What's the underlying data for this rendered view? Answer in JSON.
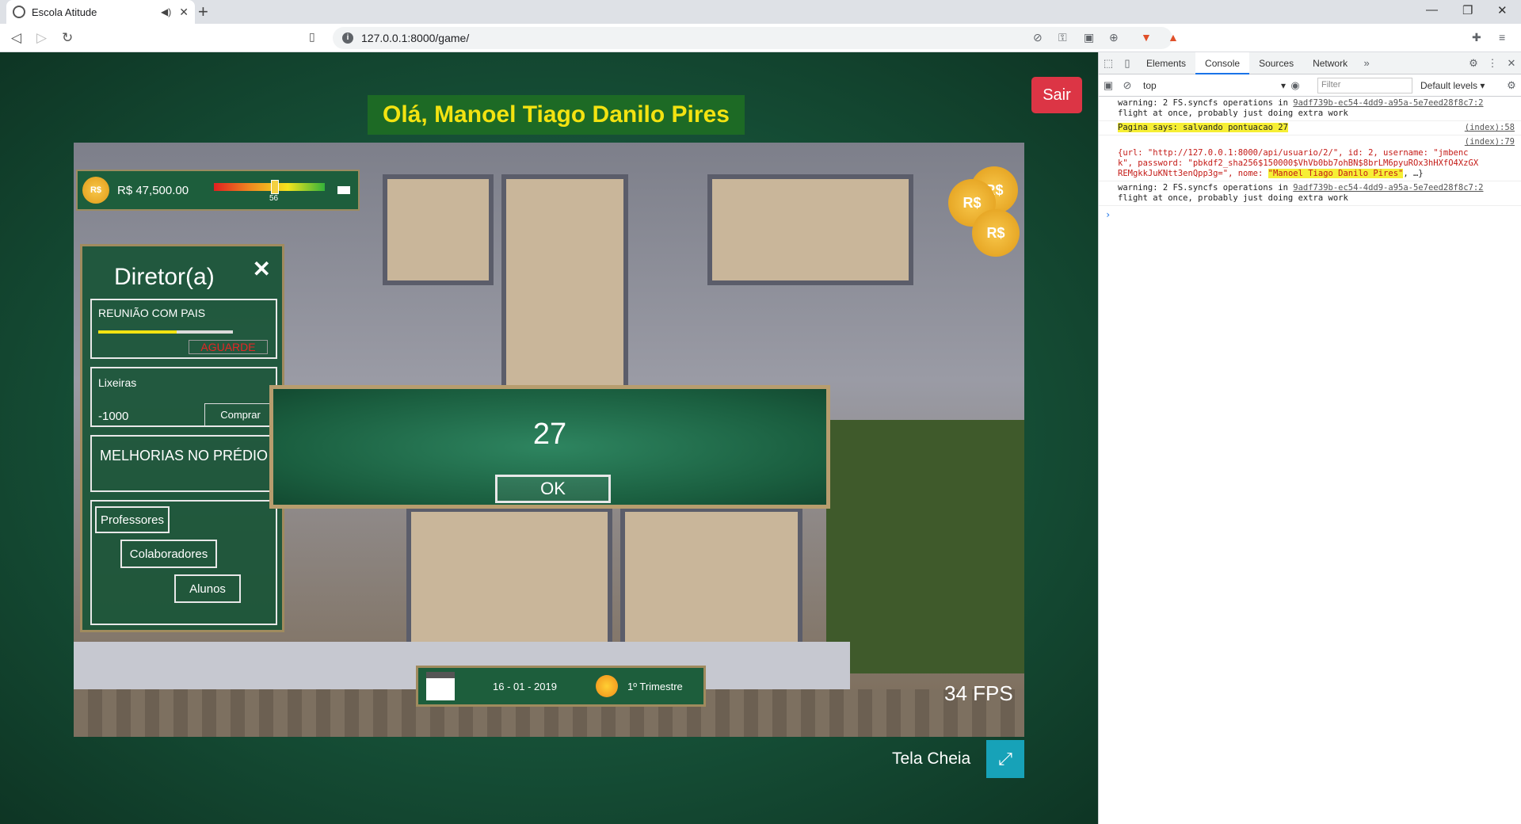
{
  "browser": {
    "tab_title": "Escola Atitude",
    "url": "127.0.0.1:8000/game/"
  },
  "game": {
    "exit_label": "Sair",
    "greeting": "Olá, Manoel Tiago Danilo Pires",
    "money_coin": "R$",
    "money": "R$ 47,500.00",
    "meter_value": 56,
    "panel": {
      "title": "Diretor(a)",
      "close": "✕",
      "meeting_label": "REUNIÃO COM PAIS",
      "meeting_progress": 0.58,
      "meeting_status": "AGUARDE",
      "bins_label": "Lixeiras",
      "bins_price": "-1000",
      "bins_buy": "Comprar",
      "improvements": "MELHORIAS NO PRÉDIO",
      "teachers": "Professores",
      "staff": "Colaboradores",
      "students": "Alunos"
    },
    "modal": {
      "score": "27",
      "ok": "OK"
    },
    "date": "16 - 01 - 2019",
    "term": "1º Trimestre",
    "fps": "34 FPS",
    "fullscreen_label": "Tela Cheia"
  },
  "devtools": {
    "tabs": [
      "Elements",
      "Console",
      "Sources",
      "Network"
    ],
    "context": "top",
    "filter_placeholder": "Filter",
    "levels": "Default levels",
    "logs": {
      "w1a": "warning: 2 FS.syncfs operations in",
      "w1src": "9adf739b-ec54-4dd9-a95a-5e7eed28f8c7:2",
      "w1b": "flight at once, probably just doing extra work",
      "alert": "Pagina says: salvando pontuacao 27",
      "alert_src": "(index):58",
      "obj_src": "(index):79",
      "obj_l1": "{url: \"http://127.0.0.1:8000/api/usuario/2/\", id: 2, username: \"jmbenc",
      "obj_l2": "k\", password: \"pbkdf2_sha256$150000$VhVb0bb7ohBN$8brLM6pyuROx3hHXfO4XzGX",
      "obj_l3a": "REMgkkJuKNtt3enQpp3g=\", nome: ",
      "obj_l3name": "\"Manoel Tiago Danilo Pires\"",
      "obj_l3b": ", …}",
      "w2a": "warning: 2 FS.syncfs operations in",
      "w2src": "9adf739b-ec54-4dd9-a95a-5e7eed28f8c7:2",
      "w2b": "flight at once, probably just doing extra work"
    }
  }
}
